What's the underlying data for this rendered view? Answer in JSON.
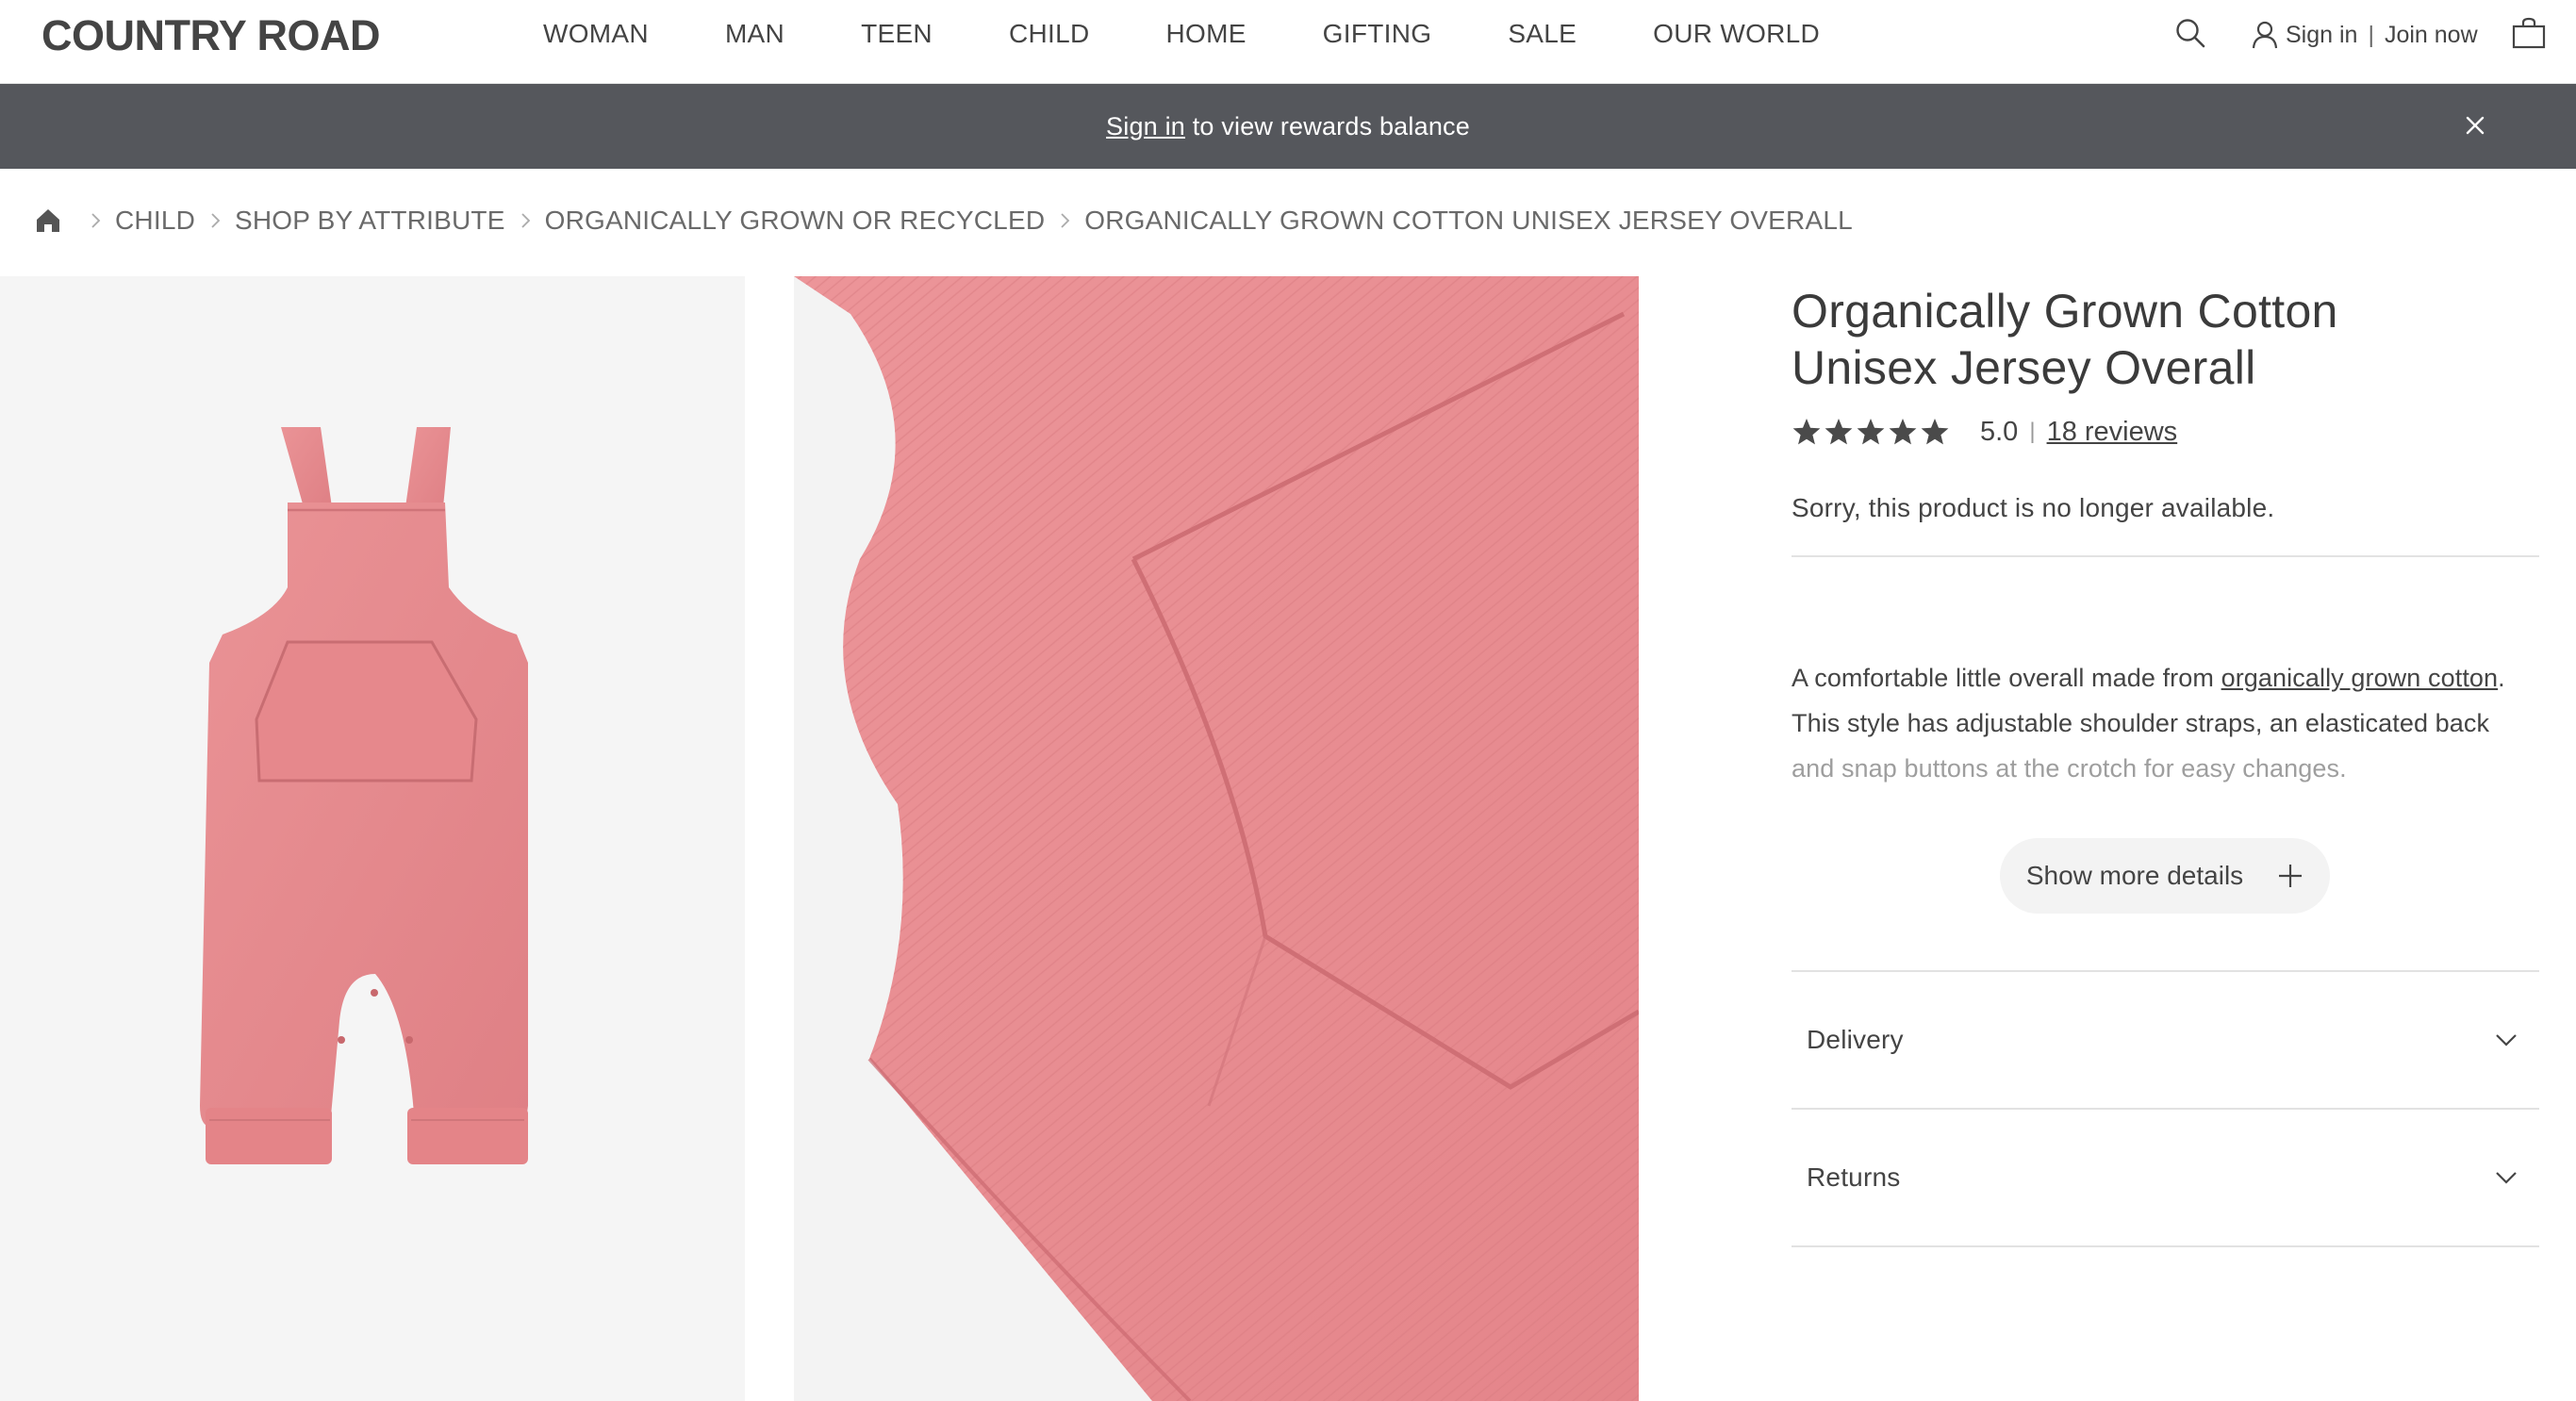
{
  "header": {
    "logo": "COUNTRY ROAD",
    "nav": [
      "WOMAN",
      "MAN",
      "TEEN",
      "CHILD",
      "HOME",
      "GIFTING",
      "SALE",
      "OUR WORLD"
    ],
    "sign_in": "Sign in",
    "separator": "|",
    "join_now": "Join now",
    "icons": {
      "search": "search-icon",
      "user": "user-icon",
      "bag": "bag-icon"
    }
  },
  "banner": {
    "link": "Sign in",
    "text": " to view rewards balance",
    "background": "#55575c"
  },
  "breadcrumb": [
    "CHILD",
    "SHOP BY ATTRIBUTE",
    "ORGANICALLY GROWN OR RECYCLED",
    "ORGANICALLY GROWN COTTON UNISEX JERSEY OVERALL"
  ],
  "product": {
    "title": "Organically Grown Cotton Unisex Jersey Overall",
    "rating": 5.0,
    "rating_text": "5.0",
    "rating_separator": "|",
    "reviews": "18 reviews",
    "unavailable": "Sorry, this product is no longer available.",
    "description_pre": "A comfortable little overall made from ",
    "description_link": "organically grown cotton",
    "description_post": ". This style has adjustable shoulder straps, an elasticated back ",
    "description_fade": "and snap buttons at the crotch for easy changes.",
    "show_more": "Show more details",
    "accordion": [
      "Delivery",
      "Returns"
    ],
    "product_color": "#e58a8e"
  }
}
